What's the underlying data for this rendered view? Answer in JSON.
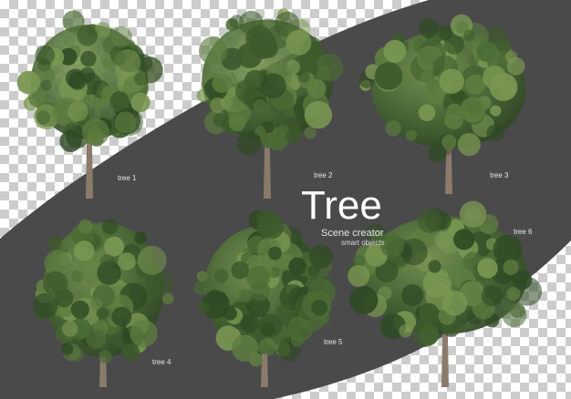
{
  "title": "Tree",
  "subtitle": "Scene creator",
  "subtitle_small": "smart objects",
  "tree_labels": [
    "tree 1",
    "tree 2",
    "tree 3",
    "tree 4",
    "tree 5",
    "tree 6"
  ],
  "colors": {
    "road": "#4a4a4a",
    "foliage_dark": "#2f4a24",
    "foliage_mid": "#4b6b35",
    "foliage_light": "#7a9652",
    "trunk": "#8a7b6a",
    "text": "#ffffff"
  }
}
